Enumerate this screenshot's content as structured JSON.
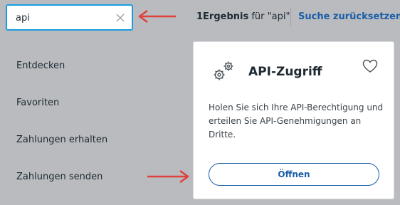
{
  "colors": {
    "page_background": "#b9bbbe",
    "focus_border": "#1a9ee3",
    "link_blue": "#1a5ea8",
    "annotation_arrow": "#e0413c"
  },
  "search": {
    "value": "api",
    "clear_icon": "close-icon"
  },
  "results": {
    "count_label": "1Ergebnis",
    "for_text": " für \"api\"",
    "reset_label": "Suche zurücksetzen"
  },
  "sidebar": {
    "items": [
      {
        "label": "Entdecken"
      },
      {
        "label": "Favoriten"
      },
      {
        "label": "Zahlungen erhalten"
      },
      {
        "label": "Zahlungen senden"
      }
    ]
  },
  "card": {
    "icon": "gears-icon",
    "title": "API-Zugriff",
    "favorite_icon": "heart-icon",
    "description": "Holen Sie sich Ihre API-Berechtigung und erteilen Sie API-Genehmigungen an Dritte.",
    "open_label": "Öffnen"
  },
  "annotations": {
    "arrow_icon": "red-arrow-icon"
  }
}
